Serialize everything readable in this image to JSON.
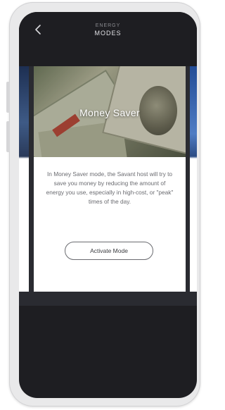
{
  "header": {
    "subtitle": "ENERGY",
    "title": "MODES"
  },
  "card": {
    "title": "Money Saver",
    "description": "In Money Saver mode, the Savant host will try to save you money by reducing the amount of energy you use, especially in high-cost, or \"peak\" times of the day.",
    "button_label": "Activate Mode"
  },
  "colors": {
    "screen_background": "#1e1e22",
    "carousel_background": "#2a2b31",
    "card_background": "#ffffff",
    "text_muted": "#6a6b70"
  },
  "icons": {
    "back": "chevron-left-icon"
  }
}
